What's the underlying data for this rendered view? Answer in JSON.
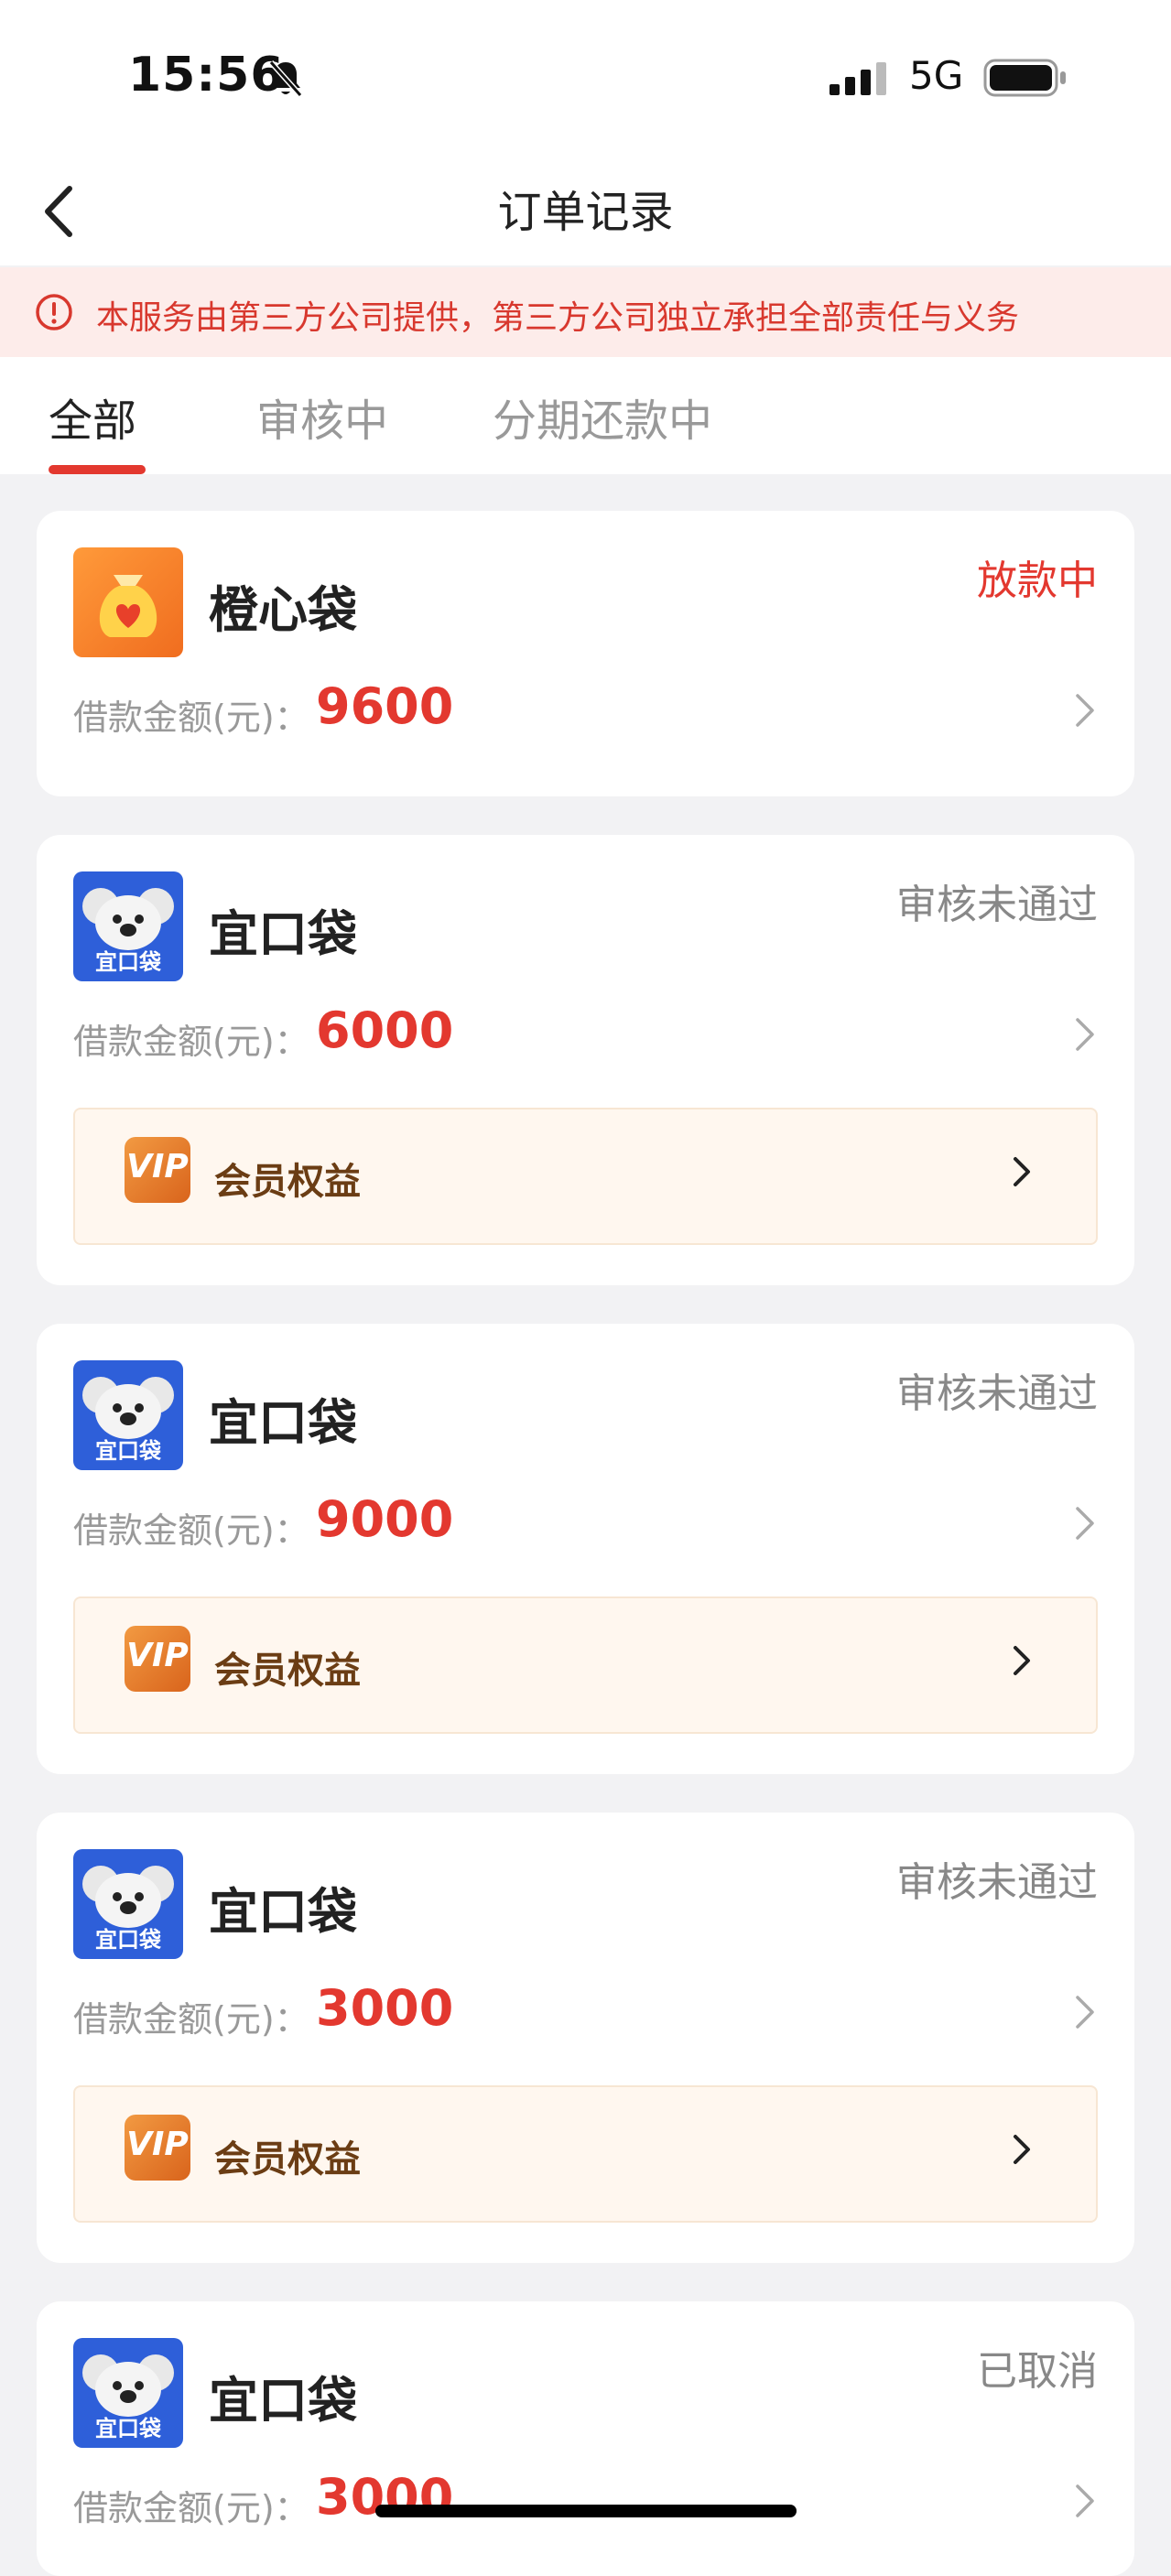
{
  "status_bar": {
    "time": "15:56",
    "network": "5G"
  },
  "header": {
    "title": "订单记录"
  },
  "notice": {
    "text": "本服务由第三方公司提供，第三方公司独立承担全部责任与义务"
  },
  "tabs": [
    {
      "label": "全部",
      "active": true
    },
    {
      "label": "审核中",
      "active": false
    },
    {
      "label": "分期还款中",
      "active": false
    }
  ],
  "orders": [
    {
      "logo": "money-bag-heart-icon",
      "logo_text": "",
      "name": "橙心袋",
      "status": "放款中",
      "amount_label": "借款金额(元)：",
      "amount": "9600",
      "has_vip": false
    },
    {
      "logo": "koala-icon",
      "logo_text": "宜口袋",
      "name": "宜口袋",
      "status": "审核未通过",
      "amount_label": "借款金额(元)：",
      "amount": "6000",
      "has_vip": true,
      "vip_label": "会员权益"
    },
    {
      "logo": "koala-icon",
      "logo_text": "宜口袋",
      "name": "宜口袋",
      "status": "审核未通过",
      "amount_label": "借款金额(元)：",
      "amount": "9000",
      "has_vip": true,
      "vip_label": "会员权益"
    },
    {
      "logo": "koala-icon",
      "logo_text": "宜口袋",
      "name": "宜口袋",
      "status": "审核未通过",
      "amount_label": "借款金额(元)：",
      "amount": "3000",
      "has_vip": true,
      "vip_label": "会员权益"
    },
    {
      "logo": "koala-icon",
      "logo_text": "宜口袋",
      "name": "宜口袋",
      "status": "已取消",
      "amount_label": "借款金额(元)：",
      "amount": "3000",
      "has_vip": false
    }
  ],
  "vip_icon_text": "VIP",
  "colors": {
    "accent": "#e3382f",
    "notice_bg": "#fdecea",
    "vip_bg": "#fff7ef",
    "logo_blue": "#2e5fd9",
    "logo_orange": "#f47b25"
  }
}
